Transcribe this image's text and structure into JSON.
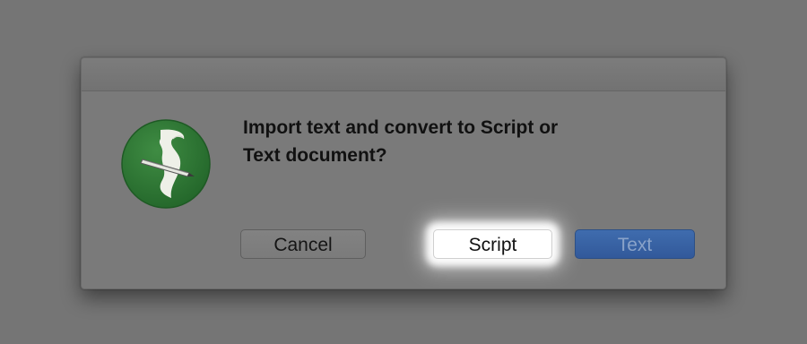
{
  "dialog": {
    "message": "Import text and convert to Script or Text document?",
    "message_line1": "Import text and convert to Script or",
    "message_line2": "Text document?",
    "app_icon": "script-app-icon",
    "buttons": {
      "cancel_label": "Cancel",
      "script_label": "Script",
      "text_label": "Text"
    }
  },
  "colors": {
    "backdrop": "#757575",
    "icon_green": "#2f7a35",
    "default_button": "#3a64a6"
  }
}
